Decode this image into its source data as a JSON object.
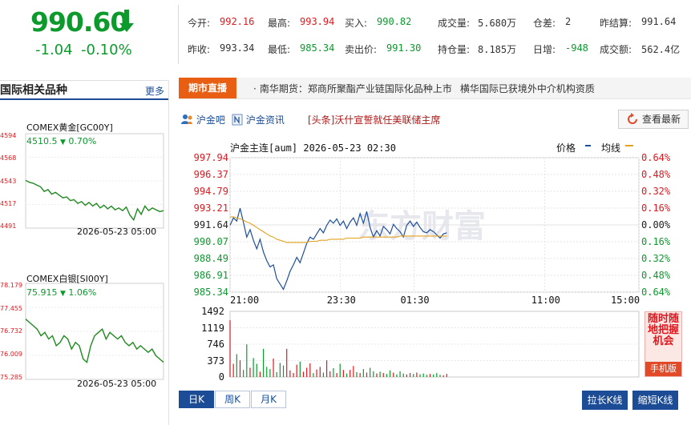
{
  "quote": {
    "price": "990.60",
    "change": "-1.04",
    "change_pct": "-0.10%",
    "fields": [
      {
        "label": "今开:",
        "value": "992.16",
        "color": "red"
      },
      {
        "label": "最高:",
        "value": "993.94",
        "color": "red"
      },
      {
        "label": "买入:",
        "value": "990.82",
        "color": "green"
      },
      {
        "label": "成交量:",
        "value": "5.680万",
        "color": "plain"
      },
      {
        "label": "仓差:",
        "value": "2",
        "color": "plain"
      },
      {
        "label": "昨结算:",
        "value": "991.64",
        "color": "plain"
      },
      {
        "label": "昨收:",
        "value": "993.34",
        "color": "plain"
      },
      {
        "label": "最低:",
        "value": "985.34",
        "color": "green"
      },
      {
        "label": "卖出价:",
        "value": "991.30",
        "color": "green"
      },
      {
        "label": "持仓量:",
        "value": "8.185万",
        "color": "plain"
      },
      {
        "label": "日增:",
        "value": "-948",
        "color": "green"
      },
      {
        "label": "成交额:",
        "value": "562.4亿",
        "color": "plain"
      }
    ]
  },
  "sidebar": {
    "title": "国际相关品种",
    "more": "更多",
    "items": [
      {
        "name": "COMEX黄金[GC00Y]",
        "price": "4510.5",
        "change": "0.70%",
        "ylabels": [
          "4594",
          "4568",
          "4543",
          "4517",
          "4491"
        ],
        "date": "2026-05-23 05:00"
      },
      {
        "name": "COMEX白银[SI00Y]",
        "price": "75.915",
        "change": "1.06%",
        "ylabels": [
          "78.179",
          "77.455",
          "76.732",
          "76.009",
          "75.285"
        ],
        "date": "2026-05-23 05:00"
      }
    ]
  },
  "news": {
    "label": "期市直播",
    "items": [
      "南华期货：郑商所聚酯产业链国际化品种上市",
      "横华国际已获境外中介机构资质"
    ]
  },
  "tools": {
    "bar_label": "沪金吧",
    "info_label": "沪金资讯",
    "headline": "[头条]沃什宣誓就任美联储主席",
    "latest_btn": "查看最新"
  },
  "chart": {
    "title": "沪金主连[aum] 2026-05-23 02:30",
    "legend_price": "价格",
    "legend_avg": "均线",
    "watermark": "东方财富",
    "promo": {
      "text": "随时随地把握机会",
      "foot": "手机版"
    },
    "periods": [
      "日K",
      "周K",
      "月K"
    ],
    "buttons": [
      "拉长K线",
      "缩短K线"
    ],
    "colors": {
      "price_line": "#1e4f9c",
      "avg_line": "#e3a21e",
      "up": "#e0181e",
      "down": "#0c9a2d"
    }
  },
  "chart_data": {
    "type": "line",
    "title": "沪金主连[aum] 2026-05-23 02:30",
    "x_ticks": [
      "21:00",
      "23:30",
      "01:30",
      "11:00",
      "15:00"
    ],
    "y_ticks_left": [
      "997.94",
      "996.37",
      "994.79",
      "993.21",
      "991.64",
      "990.07",
      "988.49",
      "986.91",
      "985.34"
    ],
    "y_ticks_right": [
      "0.64%",
      "0.48%",
      "0.32%",
      "0.16%",
      "0.00%",
      "0.16%",
      "0.32%",
      "0.48%",
      "0.64%"
    ],
    "ylim": [
      985.34,
      997.94
    ],
    "series": [
      {
        "name": "价格",
        "values": [
          991.6,
          992.3,
          992.0,
          993.2,
          991.9,
          990.5,
          991.2,
          990.2,
          989.4,
          990.3,
          989.1,
          988.3,
          987.7,
          987.9,
          986.6,
          986.1,
          985.6,
          986.4,
          987.3,
          987.9,
          988.6,
          988.1,
          989.0,
          989.9,
          990.5,
          990.3,
          990.8,
          991.3,
          990.9,
          991.6,
          992.1,
          991.8,
          992.2,
          991.6,
          992.0,
          991.3,
          991.9,
          992.3,
          991.6,
          992.7,
          991.8,
          992.9,
          991.4,
          990.5,
          991.1,
          990.6,
          991.5,
          991.2,
          990.8,
          991.7,
          991.3,
          991.0,
          990.5,
          991.6,
          992.0,
          991.5,
          991.9,
          991.4,
          991.0,
          990.9,
          991.2,
          991.0,
          990.7,
          990.4,
          990.8,
          990.9
        ]
      },
      {
        "name": "均线",
        "values": [
          992.4,
          992.4,
          992.3,
          992.2,
          992.1,
          991.9,
          991.8,
          991.6,
          991.4,
          991.2,
          991.0,
          990.8,
          990.6,
          990.5,
          990.3,
          990.2,
          990.1,
          990.0,
          990.0,
          990.0,
          990.0,
          990.0,
          990.0,
          990.0,
          990.1,
          990.1,
          990.1,
          990.2,
          990.2,
          990.2,
          990.3,
          990.3,
          990.3,
          990.3,
          990.3,
          990.4,
          990.4,
          990.4,
          990.4,
          990.4,
          990.5,
          990.5,
          990.5,
          990.5,
          990.5,
          990.5,
          990.5,
          990.5,
          990.5,
          990.5,
          990.5,
          990.6,
          990.6,
          990.6,
          990.6,
          990.6,
          990.6,
          990.6,
          990.6,
          990.6,
          990.6,
          990.6,
          990.6,
          990.6,
          990.6,
          990.6
        ]
      }
    ],
    "volume": {
      "y_ticks": [
        "1492",
        "1119",
        "746",
        "373",
        "0"
      ],
      "ylim": [
        0,
        1492
      ],
      "values": [
        1290,
        300,
        520,
        380,
        160,
        740,
        210,
        430,
        300,
        120,
        640,
        230,
        180,
        420,
        110,
        320,
        260,
        640,
        150,
        90,
        280,
        350,
        120,
        210,
        310,
        90,
        170,
        230,
        100,
        380,
        130,
        200,
        90,
        300,
        160,
        80,
        160,
        250,
        110,
        90,
        180,
        100,
        210,
        130,
        80,
        120,
        90,
        70,
        150,
        100,
        60,
        130,
        80,
        60,
        90,
        70,
        100,
        60,
        80,
        50,
        70,
        60,
        90,
        50,
        40,
        70
      ]
    },
    "mini_charts": [
      {
        "name": "COMEX黄金[GC00Y]",
        "ylim": [
          4491,
          4594
        ],
        "values": [
          4543,
          4541,
          4540,
          4538,
          4536,
          4531,
          4533,
          4528,
          4530,
          4527,
          4524,
          4525,
          4521,
          4522,
          4518,
          4520,
          4516,
          4519,
          4515,
          4518,
          4513,
          4516,
          4512,
          4515,
          4511,
          4513,
          4510,
          4514,
          4505,
          4500,
          4512,
          4506,
          4515,
          4510,
          4513,
          4511,
          4509,
          4510
        ]
      },
      {
        "name": "COMEX白银[SI00Y]",
        "ylim": [
          75.285,
          78.179
        ],
        "values": [
          77.1,
          77.0,
          76.9,
          76.8,
          76.6,
          76.7,
          76.5,
          76.6,
          76.3,
          76.4,
          76.6,
          76.5,
          76.2,
          76.4,
          76.3,
          75.9,
          75.8,
          76.3,
          76.6,
          76.7,
          76.8,
          76.5,
          76.7,
          76.6,
          76.5,
          76.6,
          76.4,
          76.3,
          76.4,
          76.2,
          76.3,
          76.2,
          76.1,
          76.2,
          76.0,
          75.9,
          75.8
        ]
      }
    ]
  }
}
